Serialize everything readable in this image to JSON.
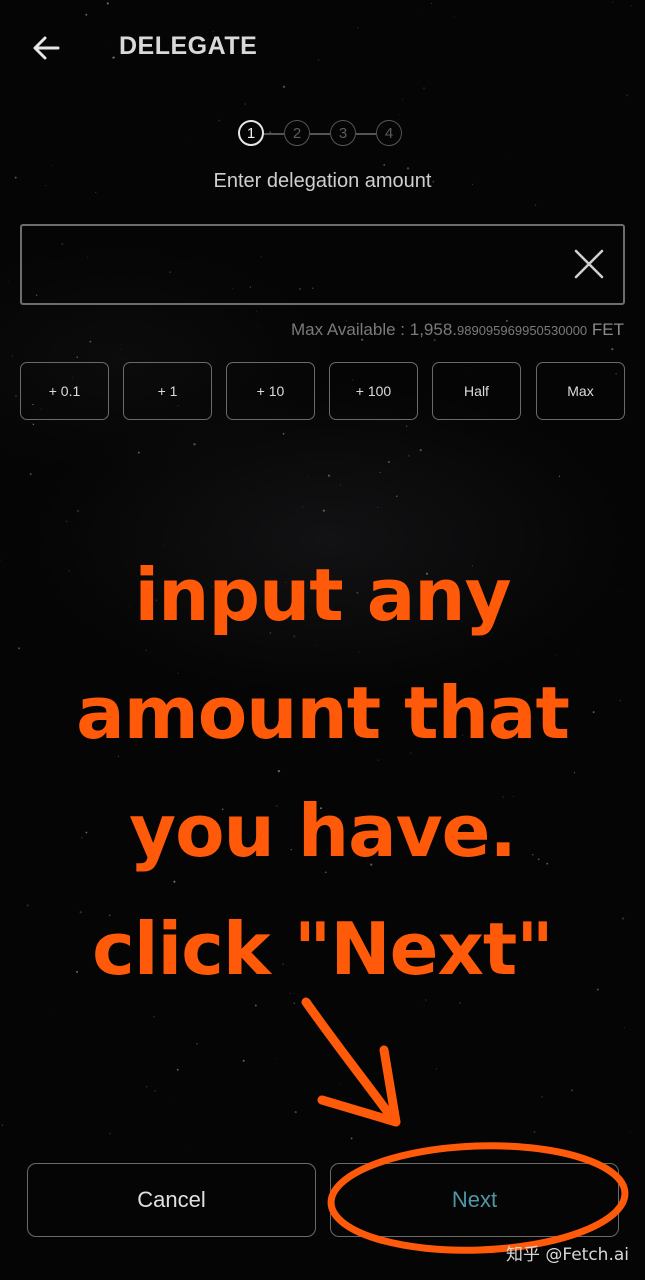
{
  "header": {
    "title": "DELEGATE",
    "back_icon": "arrow-left-icon"
  },
  "stepper": {
    "steps": [
      "1",
      "2",
      "3",
      "4"
    ],
    "active_step": 1
  },
  "form": {
    "instruction": "Enter delegation amount",
    "amount_value": "",
    "amount_placeholder": "",
    "clear_icon": "close-icon",
    "max_available": {
      "label": "Max Available : ",
      "integer_part": "1,958.",
      "fraction_part": "989095969950530000",
      "unit": " FET"
    },
    "quick_amounts": [
      "+ 0.1",
      "+ 1",
      "+ 10",
      "+ 100",
      "Half",
      "Max"
    ]
  },
  "annotation": {
    "lines": [
      "input any",
      "amount that",
      "you have.",
      "click \"Next\""
    ],
    "color": "#ff5a0a"
  },
  "actions": {
    "cancel_label": "Cancel",
    "next_label": "Next"
  },
  "watermark": "知乎 @Fetch.ai",
  "colors": {
    "background": "#050505",
    "next_text": "#4f95a8",
    "annotation": "#ff5a0a"
  }
}
